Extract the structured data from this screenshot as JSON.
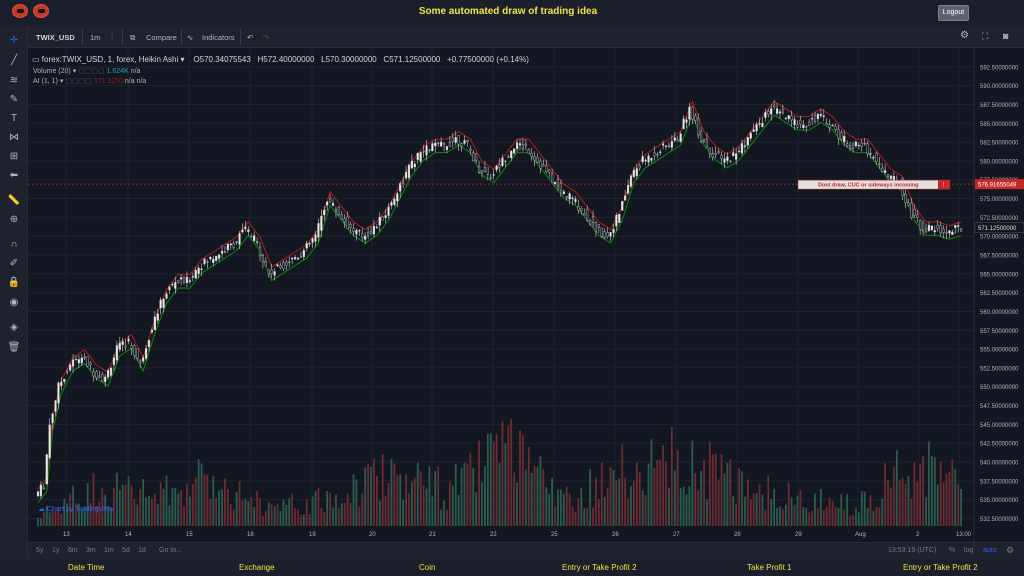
{
  "header": {
    "title": "Some automated draw of trading idea",
    "logout_label": "Logout",
    "logo_icons": [
      "robot-logo-icon",
      "robot-logo-icon"
    ]
  },
  "toolbar": {
    "symbol": "TWIX_USD",
    "interval": "1m",
    "compare_label": "Compare",
    "indicators_label": "Indicators"
  },
  "legend": {
    "series": "forex:TWIX_USD, 1, forex, Heikin Ashi",
    "open": "O570.34075543",
    "high": "H572.40000000",
    "low": "L570.30000000",
    "close": "C571.12500000",
    "change": "+0.77500000 (+0.14%)",
    "volume_label": "Volume (20)",
    "volume_value": "1.624K",
    "volume_na": "n/a",
    "ai_label": "AI (1, 1)",
    "ai_value": "571.1250",
    "ai_na1": "n/a",
    "ai_na2": "n/a"
  },
  "annotation": {
    "text": "Dont draw, CUC or sideways incoming",
    "marker": "!",
    "price_label": "576.91655049"
  },
  "last_price_label": "571.12500000",
  "bottom": {
    "ranges": [
      "5y",
      "1y",
      "6m",
      "3m",
      "1m",
      "5d",
      "1d"
    ],
    "goto_label": "Go to...",
    "clock": "13:53:19 (UTC)",
    "percent": "%",
    "log": "log",
    "auto": "auto"
  },
  "watermark": "Chart by TradingView",
  "footer": [
    "Date Time",
    "Exchange",
    "Coin",
    "Entry or Take Profit 2",
    "Take Profit 1",
    "Entry or Take Profit 2"
  ],
  "colors": {
    "up": "#26a69a",
    "down": "#ef5350",
    "title": "#f1e342",
    "green_line": "#0b8a0b",
    "red_line": "#b71c1c"
  },
  "chart_data": {
    "type": "candlestick",
    "y_ticks": [
      "592.50000000",
      "590.00000000",
      "587.50000000",
      "585.00000000",
      "582.50000000",
      "580.00000000",
      "577.50000000",
      "575.00000000",
      "572.50000000",
      "570.00000000",
      "567.50000000",
      "565.00000000",
      "562.50000000",
      "560.00000000",
      "557.50000000",
      "555.00000000",
      "552.50000000",
      "550.00000000",
      "547.50000000",
      "545.00000000",
      "542.50000000",
      "540.00000000",
      "537.50000000",
      "535.00000000",
      "532.50000000"
    ],
    "ylim": [
      531.5,
      595.0
    ],
    "x_ticks": [
      "13",
      "14",
      "15",
      "18",
      "19",
      "20",
      "21",
      "22",
      "25",
      "26",
      "27",
      "28",
      "29",
      "Aug",
      "2",
      "13:00"
    ],
    "price_path": [
      [
        0,
        535.5
      ],
      [
        3,
        537
      ],
      [
        5,
        545
      ],
      [
        8,
        550
      ],
      [
        12,
        553
      ],
      [
        16,
        554
      ],
      [
        20,
        552
      ],
      [
        24,
        551
      ],
      [
        28,
        555
      ],
      [
        32,
        556
      ],
      [
        36,
        553
      ],
      [
        40,
        558
      ],
      [
        44,
        562
      ],
      [
        48,
        564
      ],
      [
        52,
        564
      ],
      [
        56,
        566
      ],
      [
        60,
        567
      ],
      [
        64,
        568
      ],
      [
        68,
        569
      ],
      [
        72,
        571
      ],
      [
        76,
        569
      ],
      [
        80,
        565
      ],
      [
        84,
        566
      ],
      [
        88,
        567
      ],
      [
        92,
        568
      ],
      [
        96,
        570
      ],
      [
        100,
        575
      ],
      [
        104,
        573
      ],
      [
        108,
        571
      ],
      [
        112,
        570
      ],
      [
        116,
        571
      ],
      [
        120,
        573
      ],
      [
        124,
        576
      ],
      [
        128,
        579
      ],
      [
        132,
        581
      ],
      [
        136,
        582
      ],
      [
        140,
        582
      ],
      [
        144,
        583
      ],
      [
        148,
        582
      ],
      [
        152,
        579
      ],
      [
        156,
        578
      ],
      [
        160,
        580
      ],
      [
        164,
        582
      ],
      [
        168,
        582
      ],
      [
        172,
        580
      ],
      [
        176,
        578
      ],
      [
        180,
        576
      ],
      [
        184,
        575
      ],
      [
        188,
        573
      ],
      [
        192,
        571
      ],
      [
        196,
        570
      ],
      [
        200,
        573
      ],
      [
        204,
        578
      ],
      [
        208,
        580
      ],
      [
        212,
        581
      ],
      [
        216,
        582
      ],
      [
        220,
        583
      ],
      [
        224,
        587
      ],
      [
        228,
        583
      ],
      [
        232,
        581
      ],
      [
        236,
        580
      ],
      [
        240,
        581
      ],
      [
        244,
        583
      ],
      [
        248,
        585
      ],
      [
        252,
        587
      ],
      [
        256,
        586
      ],
      [
        260,
        585
      ],
      [
        264,
        585
      ],
      [
        268,
        586
      ],
      [
        272,
        585
      ],
      [
        276,
        583
      ],
      [
        280,
        582
      ],
      [
        284,
        582
      ],
      [
        288,
        580
      ],
      [
        292,
        578
      ],
      [
        296,
        577
      ],
      [
        300,
        573
      ],
      [
        304,
        571
      ],
      [
        308,
        571
      ],
      [
        312,
        570.5
      ],
      [
        316,
        571
      ]
    ],
    "volume_pattern": [
      [
        0,
        0.1
      ],
      [
        20,
        0.45
      ],
      [
        40,
        0.35
      ],
      [
        60,
        0.55
      ],
      [
        80,
        0.2
      ],
      [
        100,
        0.3
      ],
      [
        120,
        0.65
      ],
      [
        140,
        0.4
      ],
      [
        160,
        0.85
      ],
      [
        180,
        0.3
      ],
      [
        200,
        0.6
      ],
      [
        220,
        0.75
      ],
      [
        240,
        0.5
      ],
      [
        260,
        0.3
      ],
      [
        280,
        0.25
      ],
      [
        300,
        0.7
      ],
      [
        316,
        0.45
      ]
    ]
  }
}
